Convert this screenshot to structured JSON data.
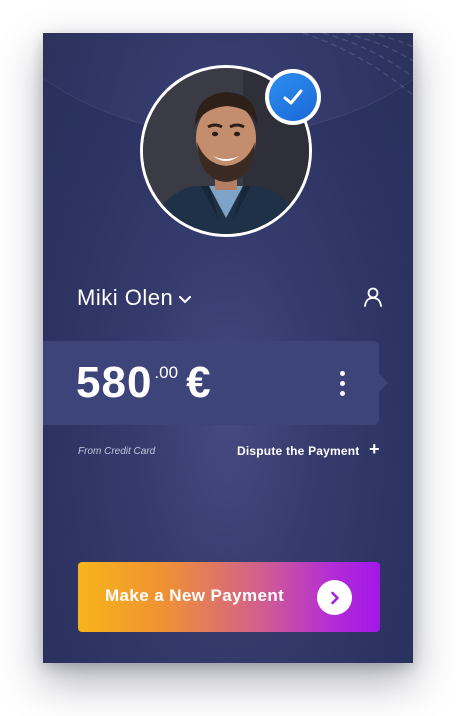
{
  "profile": {
    "name": "Miki Olen",
    "verified": true
  },
  "payment": {
    "amount_main": "580",
    "amount_cents": ".00",
    "currency": "€",
    "source": "From Credit Card",
    "dispute_label": "Dispute the Payment",
    "dispute_plus": "+"
  },
  "actions": {
    "new_payment_label": "Make a New Payment"
  },
  "icons": {
    "verified": "check-icon",
    "dropdown": "chevron-down-icon",
    "user": "user-icon",
    "more": "kebab-icon",
    "next": "chevron-right-icon"
  },
  "colors": {
    "card_bg": "#2d3461",
    "amount_card_bg": "#3d4479",
    "verified_blue": "#1f78e0",
    "button_gradient_start": "#f7b51a",
    "button_gradient_end": "#a317e8",
    "next_arrow": "#a51fe6"
  }
}
